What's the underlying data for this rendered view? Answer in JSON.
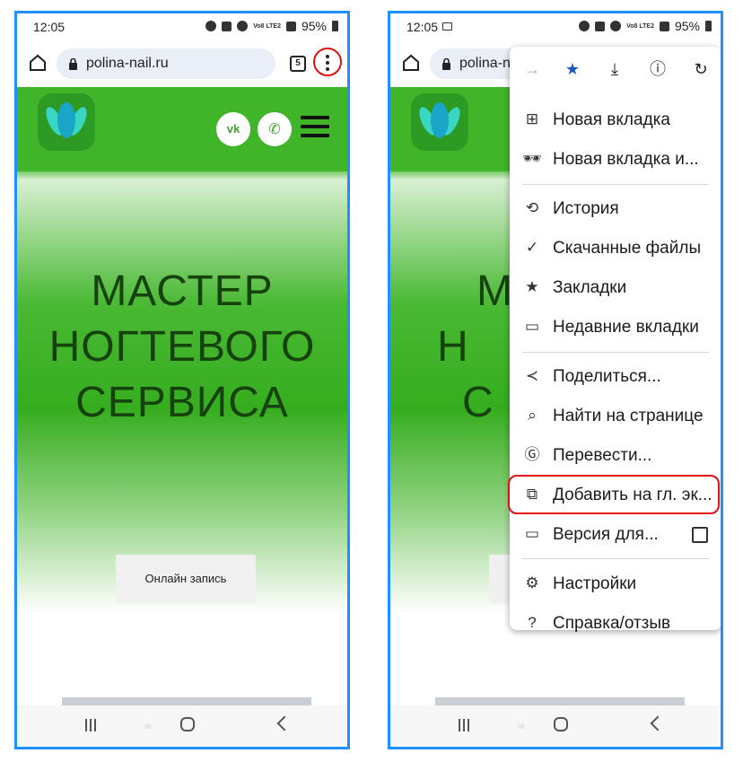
{
  "status": {
    "time": "12:05",
    "battery": "95%",
    "network": "Vo8 LTE2"
  },
  "browser": {
    "url": "polina-nail.ru",
    "tab_count": "5"
  },
  "site": {
    "hero_lines": [
      "МАСТЕР",
      "НОГТЕВОГО",
      "СЕРВИСА"
    ],
    "hero_lines_right": [
      "М",
      "Н",
      "С"
    ],
    "cta": "Онлайн запись",
    "social": {
      "vk": "vk",
      "wa": "✆"
    }
  },
  "menu": {
    "items": [
      {
        "label": "Новая вкладка",
        "icon": "new-tab-icon"
      },
      {
        "label": "Новая вкладка и...",
        "icon": "incognito-icon"
      },
      {
        "label": "История",
        "icon": "history-icon"
      },
      {
        "label": "Скачанные файлы",
        "icon": "downloads-icon"
      },
      {
        "label": "Закладки",
        "icon": "bookmark-icon"
      },
      {
        "label": "Недавние вкладки",
        "icon": "recent-tabs-icon"
      },
      {
        "label": "Поделиться...",
        "icon": "share-icon"
      },
      {
        "label": "Найти на странице",
        "icon": "find-icon"
      },
      {
        "label": "Перевести...",
        "icon": "translate-icon"
      },
      {
        "label": "Добавить на гл. эк...",
        "icon": "add-home-icon"
      },
      {
        "label": "Версия для...",
        "icon": "desktop-icon"
      },
      {
        "label": "Настройки",
        "icon": "settings-icon"
      },
      {
        "label": "Справка/отзыв",
        "icon": "help-icon"
      }
    ],
    "top_icons": [
      "forward-icon",
      "star-icon",
      "download-icon",
      "info-icon",
      "reload-icon"
    ],
    "highlight_color": "#e01010"
  },
  "colors": {
    "frame": "#1e90ff",
    "site_green": "#40b52a"
  }
}
